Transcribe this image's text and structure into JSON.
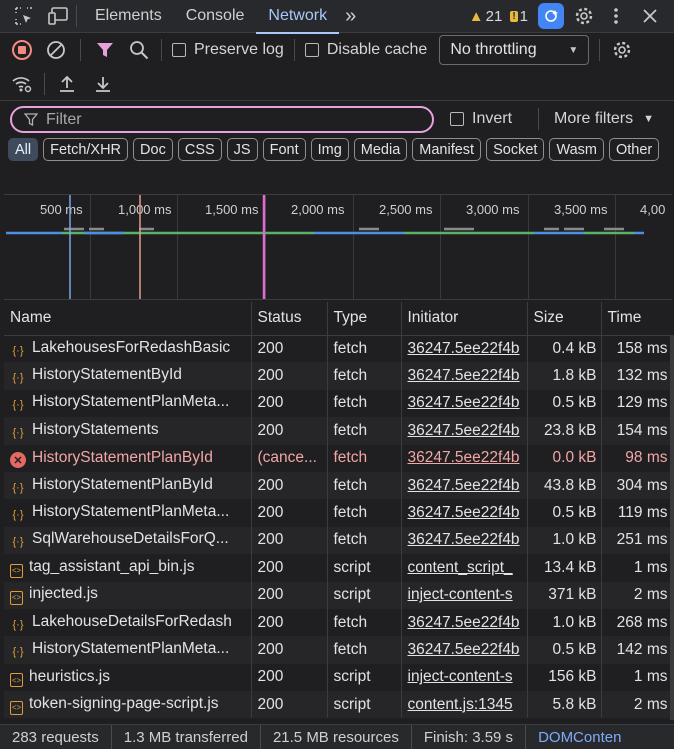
{
  "tabs": {
    "elements": "Elements",
    "console": "Console",
    "network": "Network",
    "more": "»",
    "warnings": "21",
    "issues": "1"
  },
  "toolbar": {
    "preserve_log": "Preserve log",
    "disable_cache": "Disable cache",
    "throttling": "No throttling"
  },
  "filter": {
    "placeholder": "Filter",
    "invert": "Invert",
    "more_filters": "More filters"
  },
  "chips": [
    "All",
    "Fetch/XHR",
    "Doc",
    "CSS",
    "JS",
    "Font",
    "Img",
    "Media",
    "Manifest",
    "Socket",
    "Wasm",
    "Other"
  ],
  "timeline": {
    "ticks": [
      "500 ms",
      "1,000 ms",
      "1,500 ms",
      "2,000 ms",
      "2,500 ms",
      "3,000 ms",
      "3,500 ms",
      "4,00"
    ]
  },
  "table": {
    "headers": [
      "Name",
      "Status",
      "Type",
      "Initiator",
      "Size",
      "Time"
    ],
    "rows": [
      {
        "icon": "fetch",
        "name": "LakehousesForRedashBasic",
        "status": "200",
        "type": "fetch",
        "initiator": "36247.5ee22f4b",
        "size": "0.4 kB",
        "time": "158 ms"
      },
      {
        "icon": "fetch",
        "name": "HistoryStatementById",
        "status": "200",
        "type": "fetch",
        "initiator": "36247.5ee22f4b",
        "size": "1.8 kB",
        "time": "132 ms"
      },
      {
        "icon": "fetch",
        "name": "HistoryStatementPlanMeta...",
        "status": "200",
        "type": "fetch",
        "initiator": "36247.5ee22f4b",
        "size": "0.5 kB",
        "time": "129 ms"
      },
      {
        "icon": "fetch",
        "name": "HistoryStatements",
        "status": "200",
        "type": "fetch",
        "initiator": "36247.5ee22f4b",
        "size": "23.8 kB",
        "time": "154 ms"
      },
      {
        "icon": "error",
        "name": "HistoryStatementPlanById",
        "status": "(cance...",
        "type": "fetch",
        "initiator": "36247.5ee22f4b",
        "size": "0.0 kB",
        "time": "98 ms"
      },
      {
        "icon": "fetch",
        "name": "HistoryStatementPlanById",
        "status": "200",
        "type": "fetch",
        "initiator": "36247.5ee22f4b",
        "size": "43.8 kB",
        "time": "304 ms"
      },
      {
        "icon": "fetch",
        "name": "HistoryStatementPlanMeta...",
        "status": "200",
        "type": "fetch",
        "initiator": "36247.5ee22f4b",
        "size": "0.5 kB",
        "time": "119 ms"
      },
      {
        "icon": "fetch",
        "name": "SqlWarehouseDetailsForQ...",
        "status": "200",
        "type": "fetch",
        "initiator": "36247.5ee22f4b",
        "size": "1.0 kB",
        "time": "251 ms"
      },
      {
        "icon": "script",
        "name": "tag_assistant_api_bin.js",
        "status": "200",
        "type": "script",
        "initiator": "content_script_",
        "size": "13.4 kB",
        "time": "1 ms"
      },
      {
        "icon": "script",
        "name": "injected.js",
        "status": "200",
        "type": "script",
        "initiator": "inject-content-s",
        "size": "371 kB",
        "time": "2 ms"
      },
      {
        "icon": "fetch",
        "name": "LakehouseDetailsForRedash",
        "status": "200",
        "type": "fetch",
        "initiator": "36247.5ee22f4b",
        "size": "1.0 kB",
        "time": "268 ms"
      },
      {
        "icon": "fetch",
        "name": "HistoryStatementPlanMeta...",
        "status": "200",
        "type": "fetch",
        "initiator": "36247.5ee22f4b",
        "size": "0.5 kB",
        "time": "142 ms"
      },
      {
        "icon": "script",
        "name": "heuristics.js",
        "status": "200",
        "type": "script",
        "initiator": "inject-content-s",
        "size": "156 kB",
        "time": "1 ms"
      },
      {
        "icon": "script",
        "name": "token-signing-page-script.js",
        "status": "200",
        "type": "script",
        "initiator": "content.js:1345",
        "size": "5.8 kB",
        "time": "2 ms"
      }
    ]
  },
  "status": {
    "requests": "283 requests",
    "transferred": "1.3 MB transferred",
    "resources": "21.5 MB resources",
    "finish": "Finish: 3.59 s",
    "dom": "DOMConten"
  },
  "colors": {
    "accent": "#a8c7fa",
    "filter_border": "#e7a1dd",
    "error": "#f2a6a6",
    "warning": "#e8b93c"
  }
}
